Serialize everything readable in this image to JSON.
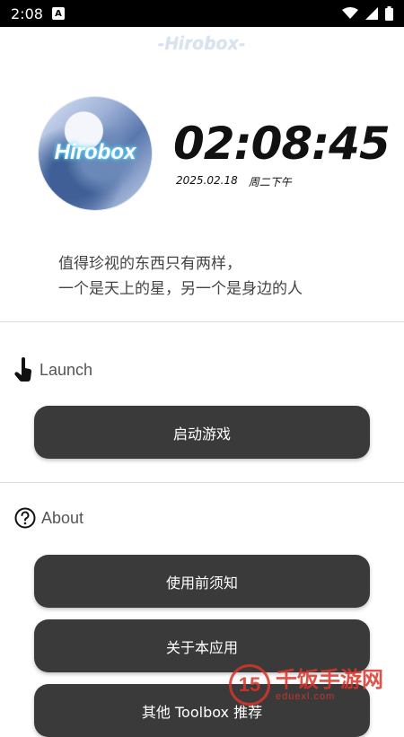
{
  "statusbar": {
    "time": "2:08",
    "app_icon_letter": "A"
  },
  "header": {
    "logo_text": "-Hirobox-"
  },
  "avatar": {
    "overlay_text": "Hirobox"
  },
  "clock": {
    "time": "02:08:45",
    "date": "2025.02.18",
    "weekday": "周二下午"
  },
  "quote": {
    "line1": "值得珍视的东西只有两样，",
    "line2": "一个是天上的星，另一个是身边的人"
  },
  "launch_section": {
    "title": "Launch",
    "icon": "touch-icon",
    "button_label": "启动游戏"
  },
  "about_section": {
    "title": "About",
    "icon": "question-circle-icon",
    "buttons": [
      "使用前须知",
      "关于本应用",
      "其他 Toolbox 推荐"
    ]
  },
  "watermark": {
    "logo_text": "15",
    "main_text": "千饭手游网",
    "sub_text": "eduexl.com"
  },
  "colors": {
    "button_bg": "#3a3a3a",
    "button_text": "#ffffff",
    "watermark_red": "#d9352a"
  }
}
